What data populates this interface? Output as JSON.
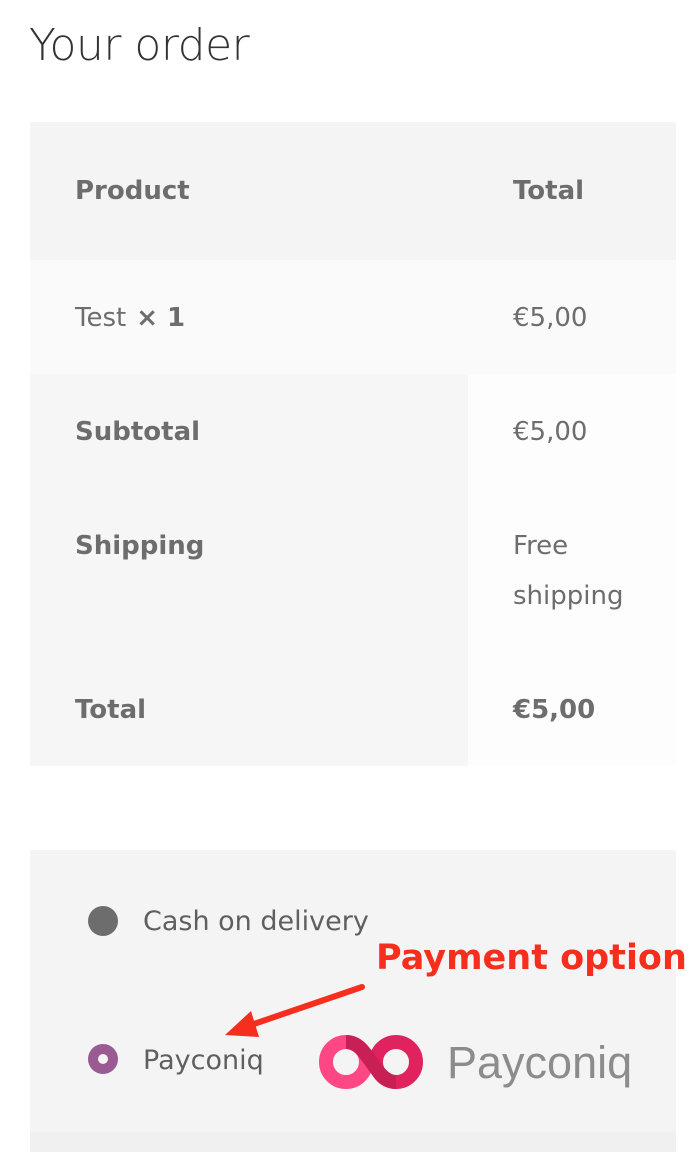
{
  "page": {
    "title": "Your order"
  },
  "order_table": {
    "headers": {
      "product": "Product",
      "total": "Total"
    },
    "items": [
      {
        "name": "Test",
        "qty": "× 1",
        "total": "€5,00"
      }
    ],
    "subtotal": {
      "label": "Subtotal",
      "value": "€5,00"
    },
    "shipping": {
      "label": "Shipping",
      "value": "Free shipping"
    },
    "total": {
      "label": "Total",
      "value": "€5,00"
    }
  },
  "payment": {
    "methods": [
      {
        "label": "Cash on delivery",
        "selected": false
      },
      {
        "label": "Payconiq",
        "selected": true,
        "logo_text": "Payconiq"
      }
    ]
  },
  "annotation": {
    "text": "Payment option",
    "color": "#f62e1e"
  },
  "colors": {
    "radio_selected": "#9a5a92",
    "radio_unselected": "#6d6d6d",
    "payconiq_pink": "#ff4785",
    "payconiq_red": "#e0235f"
  },
  "icons": {
    "arrow": "annotation-arrow-icon",
    "logo": "payconiq-logo-icon"
  }
}
